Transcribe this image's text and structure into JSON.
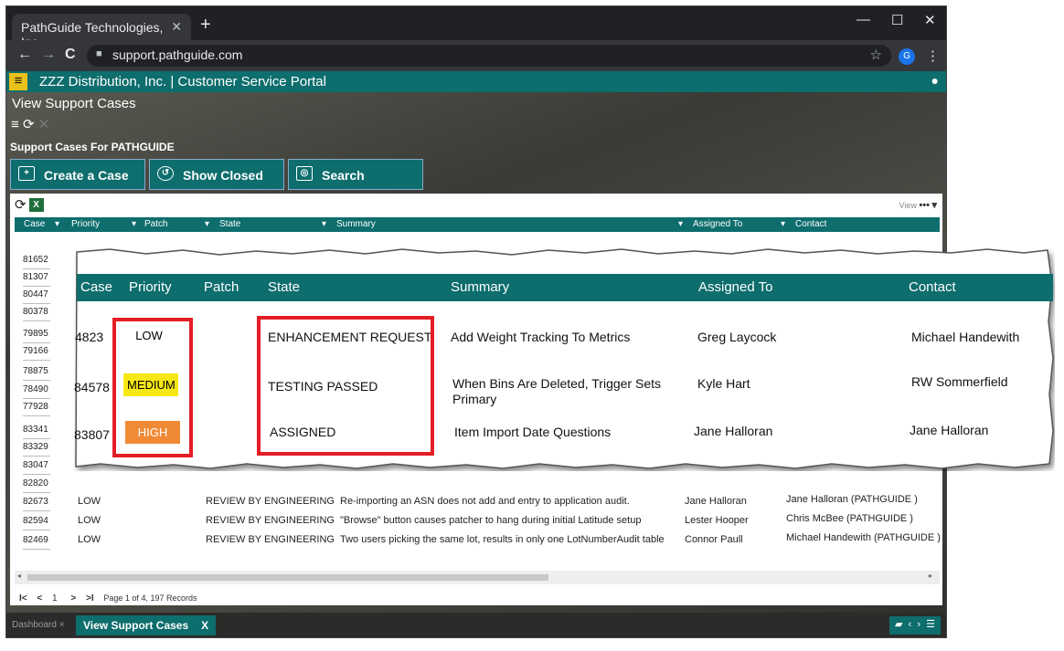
{
  "browser": {
    "tab_title": "PathGuide Technologies, Inc.",
    "tab_close": "✕",
    "new_tab": "+",
    "url": "support.pathguide.com",
    "profile_initial": "G",
    "min": "—",
    "max": "☐",
    "close": "✕",
    "back": "←",
    "forward": "→",
    "reload": "C"
  },
  "app": {
    "title": "ZZZ Distribution, Inc. | Customer Service Portal",
    "page_title": "View Support Cases",
    "section_title": "Support Cases For PATHGUIDE",
    "buttons": {
      "create": "Create a Case",
      "show_closed": "Show Closed",
      "search": "Search"
    }
  },
  "grid": {
    "view_label": "View",
    "columns": [
      "Case",
      "Priority",
      "Patch",
      "State",
      "Summary",
      "Assigned To",
      "Contact"
    ],
    "case_numbers": [
      "81652",
      "81307",
      "80447",
      "80378",
      "79895",
      "79166",
      "78875",
      "78490",
      "77928",
      "83341",
      "83329",
      "83047",
      "82820",
      "82673",
      "82594",
      "82469"
    ],
    "rows": [
      {
        "priority": "LOW",
        "state": "REVIEW BY ENGINEERING",
        "summary": "Re-importing an ASN does not add and entry to application audit.",
        "assigned": "Jane Halloran",
        "contact": "Jane Halloran (PATHGUIDE )"
      },
      {
        "priority": "LOW",
        "state": "REVIEW BY ENGINEERING",
        "summary": "\"Browse\" button causes patcher to hang during initial Latitude setup",
        "assigned": "Lester Hooper",
        "contact": "Chris McBee (PATHGUIDE )"
      },
      {
        "priority": "LOW",
        "state": "REVIEW BY ENGINEERING",
        "summary": "Two users picking the same lot, results in only one LotNumberAudit table",
        "assigned": "Connor Paull",
        "contact": "Michael Handewith (PATHGUIDE )"
      }
    ],
    "pager": {
      "first": "I<",
      "prev": "<",
      "page": "1",
      "next": ">",
      "last": ">I",
      "text": "Page 1 of 4, 197 Records"
    }
  },
  "zoom": {
    "columns": [
      "Case",
      "Priority",
      "Patch",
      "State",
      "Summary",
      "Assigned To",
      "Contact"
    ],
    "rows": [
      {
        "case": "4823",
        "priority": "LOW",
        "state": "ENHANCEMENT REQUEST",
        "summary": "Add Weight Tracking To Metrics",
        "assigned": "Greg Laycock",
        "contact": "Michael Handewith"
      },
      {
        "case": "84578",
        "priority": "MEDIUM",
        "state": "TESTING PASSED",
        "summary": "When Bins Are Deleted, Trigger Sets Primary",
        "assigned": "Kyle Hart",
        "contact": "RW Sommerfield"
      },
      {
        "case": "83807",
        "priority": "HIGH",
        "state": "ASSIGNED",
        "summary": "Item Import Date Questions",
        "assigned": "Jane Halloran",
        "contact": "Jane Halloran"
      }
    ]
  },
  "taskbar": {
    "dashboard": "Dashboard",
    "dash_close": "×",
    "active_tab": "View Support Cases",
    "active_close": "X"
  },
  "colors": {
    "teal": "#0e6d6d",
    "medium": "#f6e814",
    "high": "#f08a35",
    "highlight": "#e41e26",
    "menu": "#e8c21b"
  }
}
